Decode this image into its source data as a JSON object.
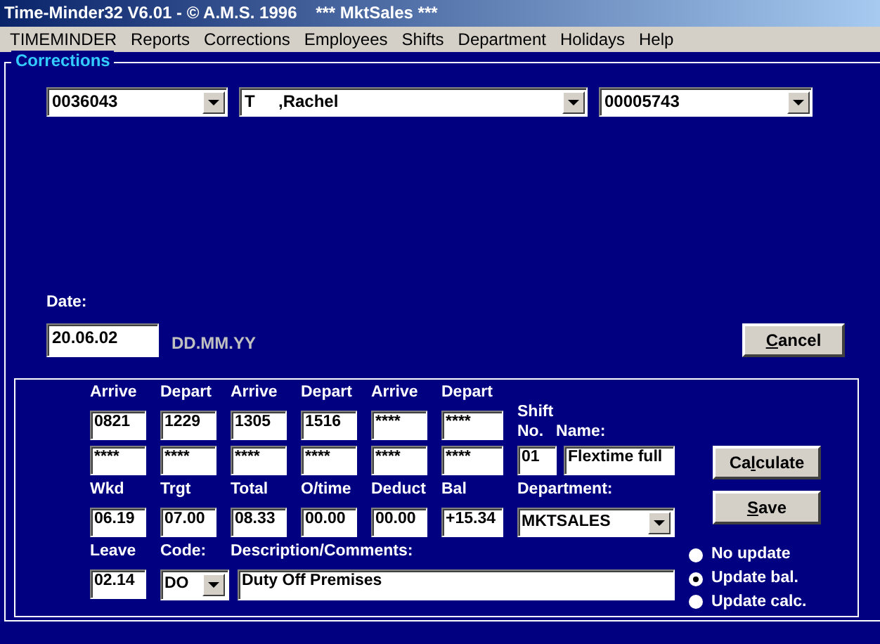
{
  "window": {
    "title": "Time-Minder32 V6.01 - © A.M.S. 1996    *** MktSales ***"
  },
  "menu": [
    "TIMEMINDER",
    "Reports",
    "Corrections",
    "Employees",
    "Shifts",
    "Department",
    "Holidays",
    "Help"
  ],
  "corrections": {
    "title": "Corrections",
    "employee_number": "0036043",
    "employee_name": "T     ,Rachel",
    "card_number": "00005743",
    "date_label": "Date:",
    "date": "20.06.02",
    "date_format": "DD.MM.YY",
    "cancel_button": {
      "label": {
        "mnemonic": "C",
        "after": "ancel"
      }
    }
  },
  "times": {
    "headers": [
      "Arrive",
      "Depart",
      "Arrive",
      "Depart",
      "Arrive",
      "Depart"
    ],
    "rows": [
      [
        "0821",
        "1229",
        "1305",
        "1516",
        "****",
        "****"
      ],
      [
        "****",
        "****",
        "****",
        "****",
        "****",
        "****"
      ]
    ]
  },
  "totals": {
    "headers": [
      "Wkd",
      "Trgt",
      "Total",
      "O/time",
      "Deduct",
      "Bal"
    ],
    "values": [
      "06.19",
      "07.00",
      "08.33",
      "00.00",
      "00.00",
      "+15.34"
    ]
  },
  "shift": {
    "title": "Shift",
    "number_label": "No.",
    "name_label": "Name:",
    "number": "01",
    "name": "Flextime full",
    "department_label": "Department:",
    "department": "MKTSALES"
  },
  "leave": {
    "leave_label": "Leave",
    "code_label": "Code:",
    "description_label": "Description/Comments:",
    "leave": "02.14",
    "code": "DO",
    "description": "Duty Off Premises"
  },
  "actions": [
    {
      "label": {
        "before": "Ca",
        "mnemonic": "l",
        "after": "culate"
      }
    },
    {
      "label": {
        "mnemonic": "S",
        "after": "ave"
      }
    }
  ],
  "update_options": [
    {
      "label": "No update",
      "selected": false
    },
    {
      "label": "Update bal.",
      "selected": true
    },
    {
      "label": "Update calc.",
      "selected": false
    }
  ]
}
